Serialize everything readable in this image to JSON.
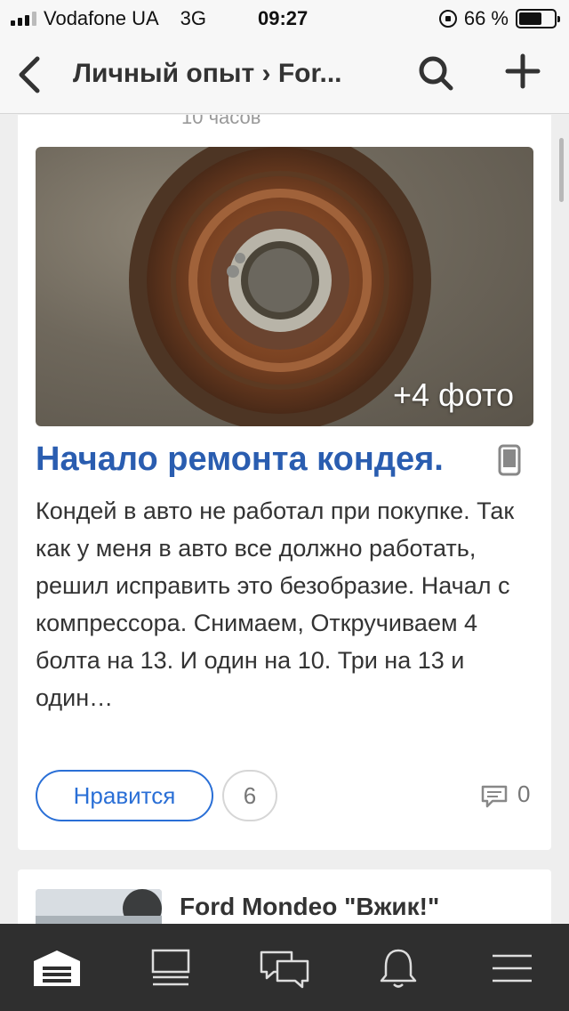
{
  "status_bar": {
    "carrier": "Vodafone UA",
    "network": "3G",
    "time": "09:27",
    "battery_text": "66 %",
    "battery_level": 0.66
  },
  "nav": {
    "title": "Личный опыт › For...",
    "back_icon": "chevron-left-icon",
    "search_icon": "search-icon",
    "add_icon": "plus-icon"
  },
  "post": {
    "time": "10 часов",
    "photo_more": "+4 фото",
    "title": "Начало ремонта кондея.",
    "text": "Кондей в авто не работал при покупке. Так как у меня в авто все должно работать, решил исправить это безобразие. Начал с компрессора. Снимаем, Откручиваем 4 болта на 13. И один на 10. Три на 13 и один…",
    "like_label": "Нравится",
    "like_count": "6",
    "comment_count": "0"
  },
  "next_post": {
    "title": "Ford Mondeo \"Вжик!\""
  },
  "tabbar": {
    "items": [
      "garage-icon",
      "feed-icon",
      "messages-icon",
      "notifications-icon",
      "menu-icon"
    ]
  },
  "colors": {
    "accent": "#2a6fd6",
    "title": "#2a5db0",
    "tabbar": "#2f2f2f"
  }
}
